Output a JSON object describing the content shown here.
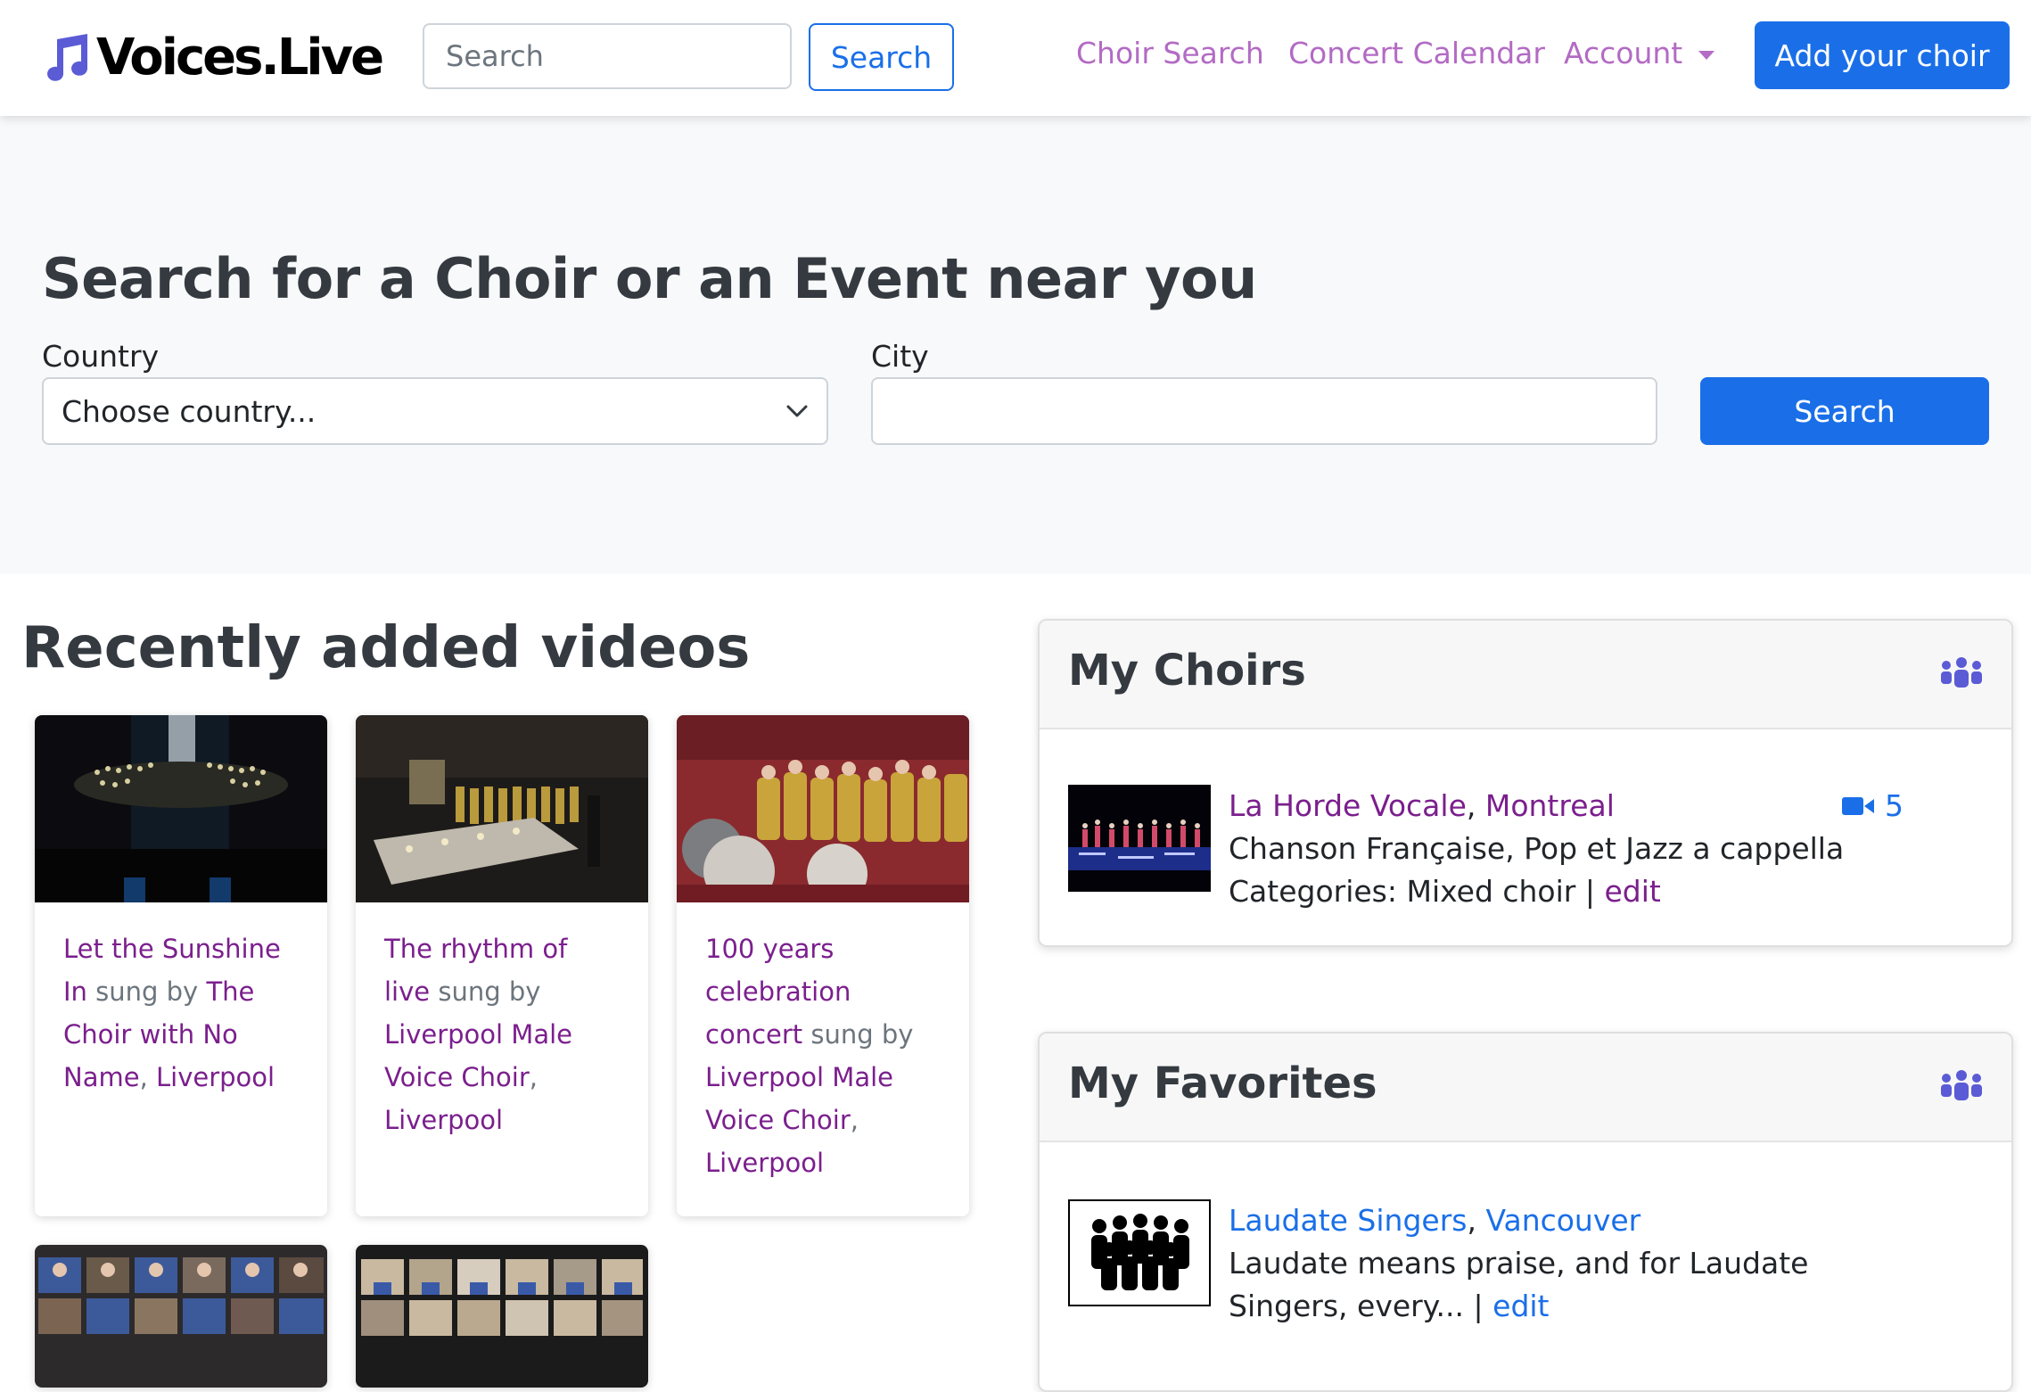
{
  "brand": {
    "name": "Voices.Live"
  },
  "navbar": {
    "search_placeholder": "Search",
    "search_button": "Search",
    "links": [
      "Choir Search",
      "Concert Calendar",
      "Account"
    ],
    "add_choir": "Add your choir"
  },
  "hero": {
    "title": "Search for a Choir or an Event near you",
    "country_label": "Country",
    "country_selected": "Choose country...",
    "city_label": "City",
    "city_value": "",
    "search_button": "Search"
  },
  "videos": {
    "heading": "Recently added videos",
    "sung_by": "sung by",
    "items": [
      {
        "title": "Let the Sunshine In",
        "choir": "The Choir with No Name",
        "city": "Liverpool"
      },
      {
        "title": "The rhythm of live",
        "choir": "Liverpool Male Voice Choir",
        "city": "Liverpool"
      },
      {
        "title": "100 years celebration concert",
        "choir": "Liverpool Male Voice Choir",
        "city": "Liverpool"
      }
    ]
  },
  "my_choirs": {
    "title": "My Choirs",
    "entry": {
      "name": "La Horde Vocale",
      "city": "Montreal",
      "video_count": "5",
      "description": "Chanson Française, Pop et Jazz a cappella",
      "categories": "Categories: Mixed choir",
      "edit": "edit"
    }
  },
  "my_favorites": {
    "title": "My Favorites",
    "entry": {
      "name": "Laudate Singers",
      "city": "Vancouver",
      "description_line1": "Laudate means praise, and for Laudate",
      "description_line2": "Singers, every...",
      "edit": "edit"
    }
  },
  "colors": {
    "primary": "#1a6fe8",
    "nav_link": "#b36bc4",
    "link_purple": "#7b1f8d",
    "brand_note": "#5b5bd6",
    "heading": "#343a40"
  }
}
